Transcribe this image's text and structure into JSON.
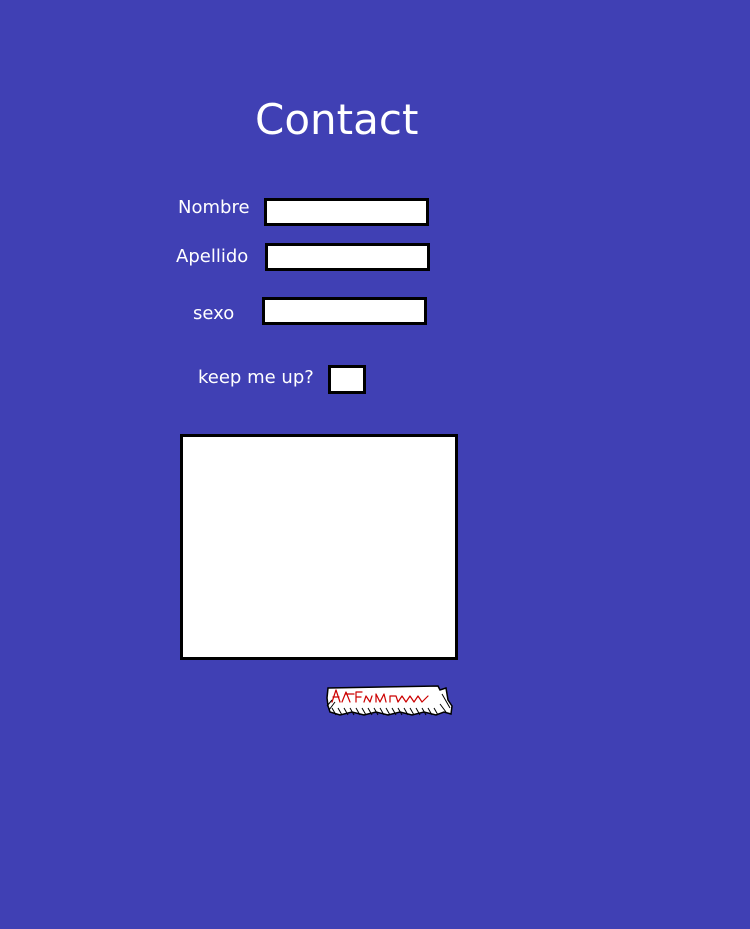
{
  "page": {
    "title": "Contact"
  },
  "form": {
    "nombre": {
      "label": "Nombre",
      "value": ""
    },
    "apellido": {
      "label": "Apellido",
      "value": ""
    },
    "sexo": {
      "label": "sexo",
      "value": ""
    },
    "newsletter": {
      "label": "keep me up?",
      "checked": false
    },
    "message": {
      "value": ""
    }
  },
  "captcha": {
    "ink_color": "#cc0000",
    "paper_color": "#ffffff"
  },
  "colors": {
    "background": "#4040b4",
    "text": "#ffffff",
    "border": "#000000"
  }
}
